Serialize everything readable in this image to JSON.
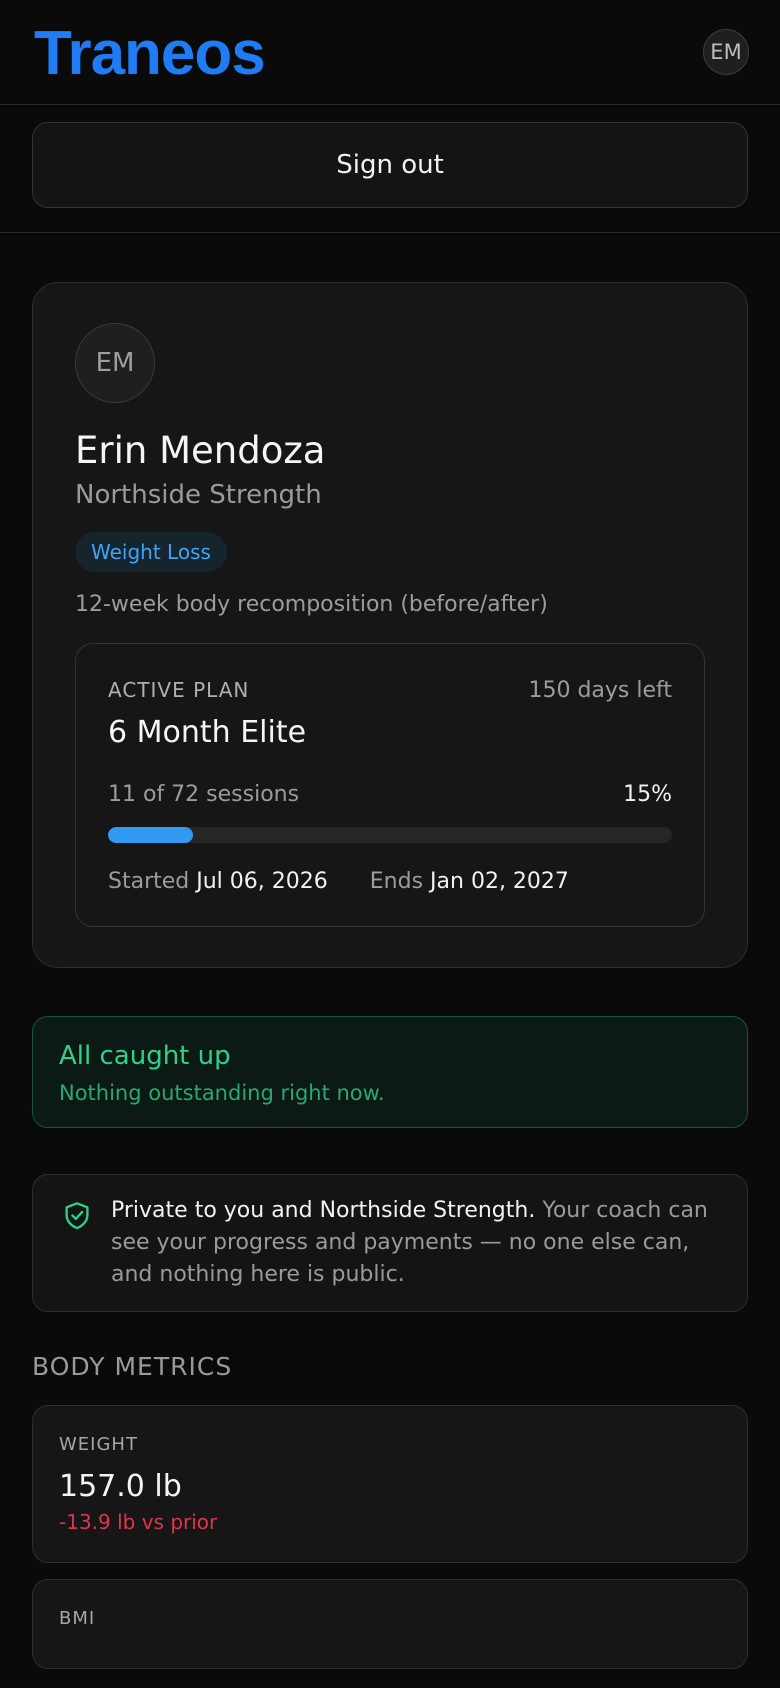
{
  "header": {
    "logo": "Traneos",
    "avatar_initials": "EM"
  },
  "signout_label": "Sign out",
  "profile": {
    "initials": "EM",
    "name": "Erin Mendoza",
    "gym": "Northside Strength",
    "tag": "Weight Loss",
    "goal": "12-week body recomposition (before/after)",
    "plan": {
      "label": "ACTIVE PLAN",
      "days_left": "150 days left",
      "name": "6 Month Elite",
      "sessions": "11 of 72 sessions",
      "percent": "15%",
      "progress_fraction": 0.15,
      "started_label": "Started",
      "started_value": "Jul 06, 2026",
      "ends_label": "Ends",
      "ends_value": "Jan 02, 2027"
    }
  },
  "status": {
    "title": "All caught up",
    "subtitle": "Nothing outstanding right now."
  },
  "privacy": {
    "strong": "Private to you and Northside Strength.",
    "rest": " Your coach can see your progress and payments — no one else can, and nothing here is public."
  },
  "body_metrics": {
    "title": "BODY METRICS",
    "items": [
      {
        "label": "WEIGHT",
        "value": "157.0 lb",
        "delta": "-13.9 lb vs prior"
      },
      {
        "label": "BMI"
      }
    ]
  },
  "colors": {
    "accent": "#1f7cf2",
    "progress": "#3299f2",
    "success": "#2fd18a",
    "negative": "#e0344d"
  }
}
